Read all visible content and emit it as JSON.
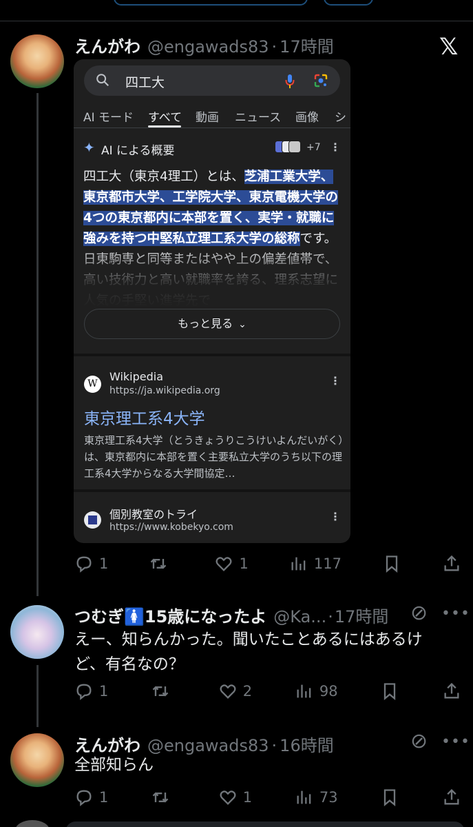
{
  "tweet1": {
    "name": "えんがわ",
    "handle": "@engawads83",
    "time": "17時間",
    "actions": {
      "reply": "1",
      "retweet": "",
      "like": "1",
      "views": "117"
    },
    "screenshot": {
      "search_query": "四工大",
      "tabs": [
        "AI モード",
        "すべて",
        "動画",
        "ニュース",
        "画像",
        "シ"
      ],
      "active_tab": "すべて",
      "ai_title": "AI による概要",
      "ai_sources_more": "+7",
      "ai_text_intro": "四工大（東京4理工）とは、",
      "ai_text_highlight": "芝浦工業大学、東京都市大学、工学院大学、東京電機大学の4つの東京都内に本部を置く、実学・就職に強みを持つ中堅私立理工系大学の総称",
      "ai_text_rest": "です。日東駒専と同等またはやや上の偏差値帯で、高い技術力と高い就職率を誇る、理系志望に人気の手堅い進学先で",
      "more_button": "もっと見る",
      "result1": {
        "site": "Wikipedia",
        "favicon": "W",
        "url": "https://ja.wikipedia.org",
        "title": "東京理工系4大学",
        "snippet": "東京理工系4大学（とうきょうりこうけいよんだいがく）は、東京都内に本部を置く主要私立大学のうち以下の理工系4大学からなる大学間協定…"
      },
      "result2": {
        "site": "個別教室のトライ",
        "url": "https://www.kobekyo.com"
      }
    }
  },
  "tweet2": {
    "name": "つむぎ🚺15歳になったよ",
    "handle": "@Ka...",
    "time": "17時間",
    "text": "えー、知らんかった。聞いたことあるにはあるけど、有名なの？",
    "actions": {
      "reply": "1",
      "retweet": "",
      "like": "2",
      "views": "98"
    }
  },
  "tweet3": {
    "name": "えんがわ",
    "handle": "@engawads83",
    "time": "16時間",
    "text": "全部知らん",
    "actions": {
      "reply": "1",
      "retweet": "",
      "like": "1",
      "views": "73"
    }
  },
  "icons": [
    "x-logo-icon",
    "reply-icon",
    "retweet-icon",
    "like-icon",
    "views-icon",
    "bookmark-icon",
    "share-icon",
    "grok-icon",
    "more-icon",
    "search-icon",
    "mic-icon",
    "lens-icon",
    "sparkle-icon",
    "kebab-icon",
    "chevron-down-icon"
  ],
  "colors": {
    "background": "#000000",
    "secondary_text": "#71767b",
    "search_link": "#8ab4f8",
    "highlight": "#2c4c96"
  }
}
